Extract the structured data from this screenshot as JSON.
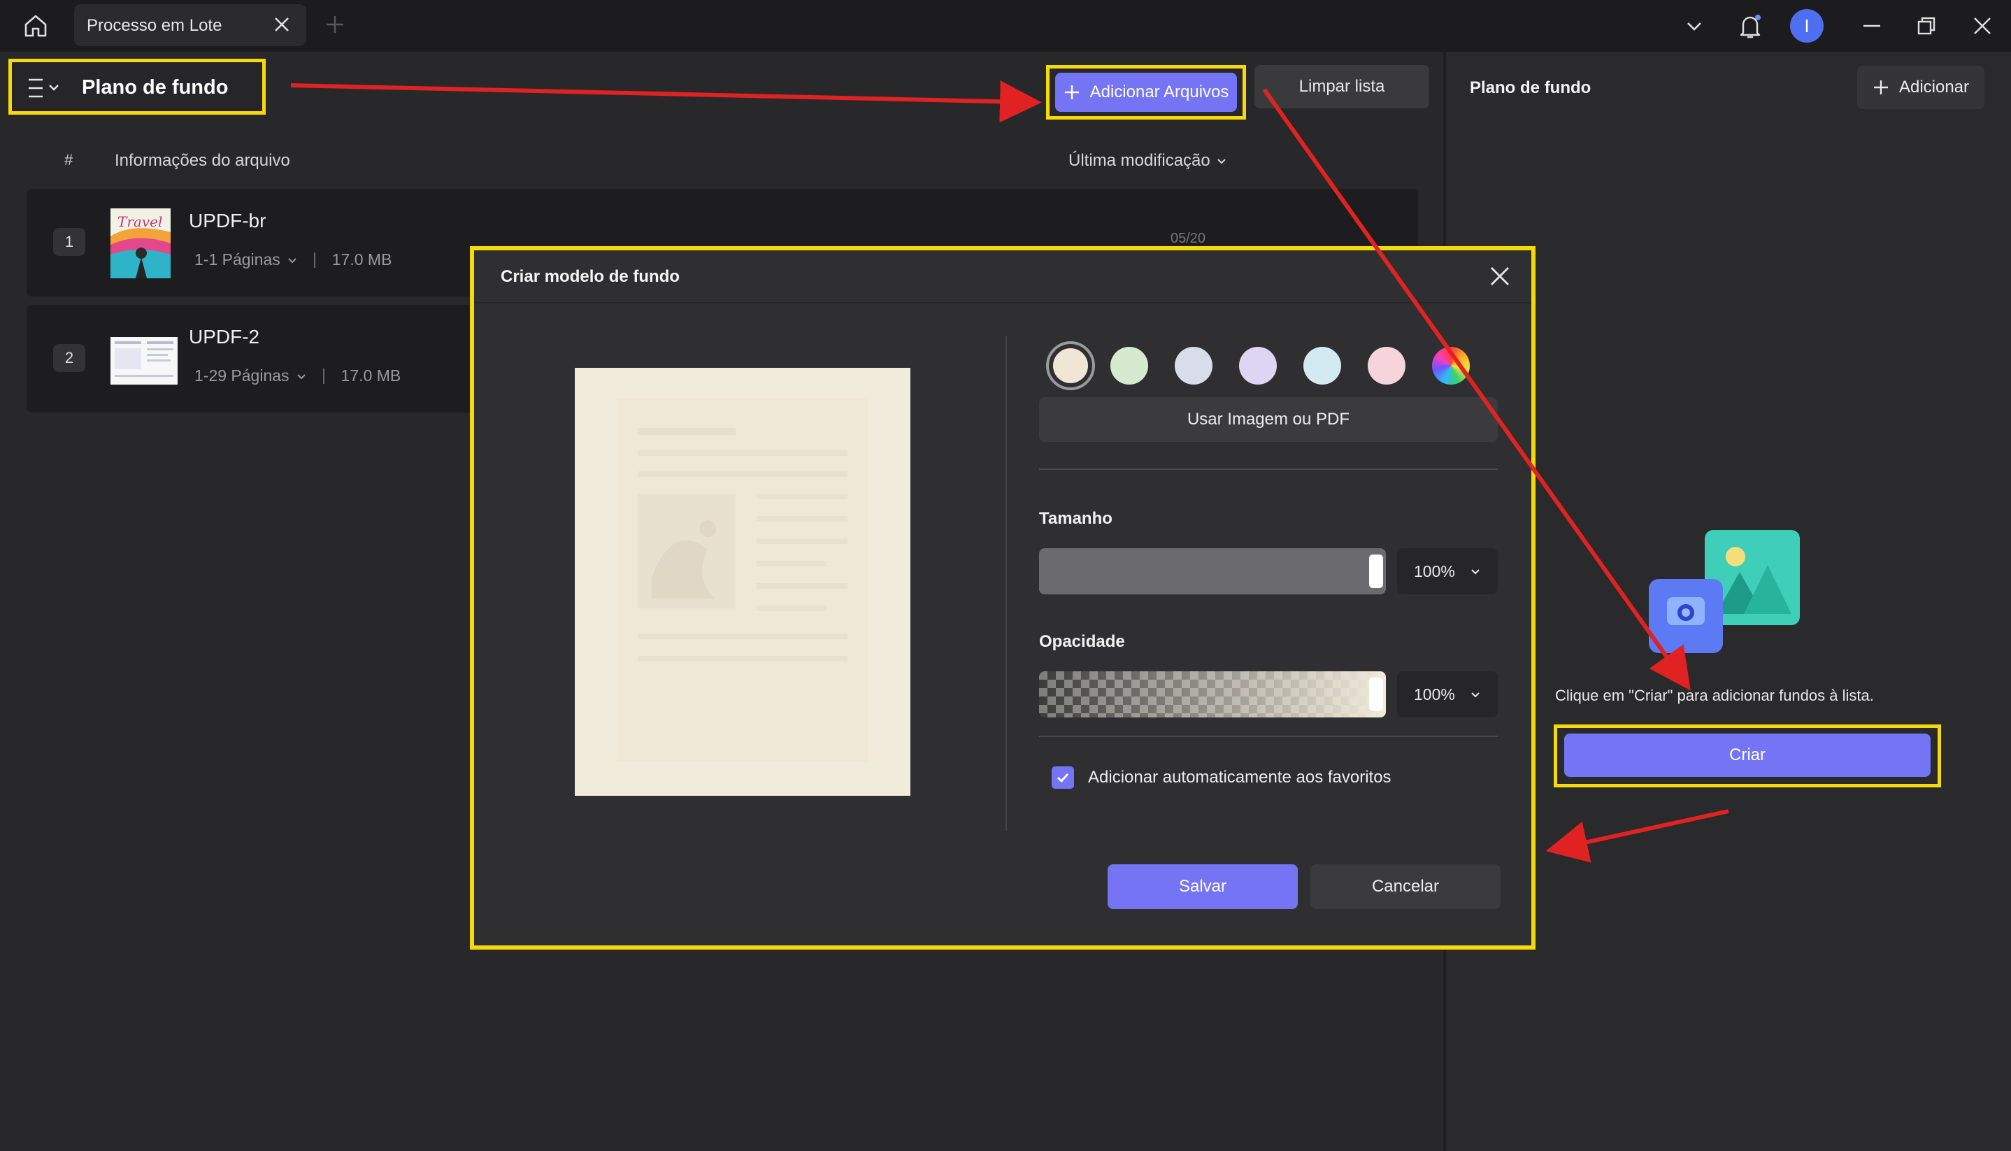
{
  "titlebar": {
    "tab_title": "Processo em Lote",
    "avatar_initial": "I"
  },
  "toolbar": {
    "mode_title": "Plano de fundo",
    "add_files_label": "Adicionar Arquivos",
    "clear_list_label": "Limpar lista"
  },
  "file_list": {
    "columns": {
      "number": "#",
      "info": "Informações do arquivo",
      "modified": "Última modificação"
    },
    "rows": [
      {
        "index": "1",
        "name": "UPDF-br",
        "pages": "1-1 Páginas",
        "size": "17.0 MB",
        "date": "05/20"
      },
      {
        "index": "2",
        "name": "UPDF-2",
        "pages": "1-29 Páginas",
        "size": "17.0 MB"
      }
    ]
  },
  "right_panel": {
    "title": "Plano de fundo",
    "add_label": "Adicionar",
    "hint": "Clique em \"Criar\" para adicionar fundos à lista.",
    "create_label": "Criar"
  },
  "dialog": {
    "title": "Criar modelo de fundo",
    "swatch_colors": [
      "#efe6d6",
      "#d6ead0",
      "#d8dde9",
      "#dcd6f2",
      "#d4eaf2",
      "#f6d4dc"
    ],
    "use_image_label": "Usar Imagem ou PDF",
    "size_label": "Tamanho",
    "size_value": "100%",
    "size_level": 1.0,
    "opacity_label": "Opacidade",
    "opacity_value": "100%",
    "opacity_level": 1.0,
    "auto_favorite_label": "Adicionar automaticamente aos favoritos",
    "auto_favorite_checked": true,
    "save_label": "Salvar",
    "cancel_label": "Cancelar"
  }
}
